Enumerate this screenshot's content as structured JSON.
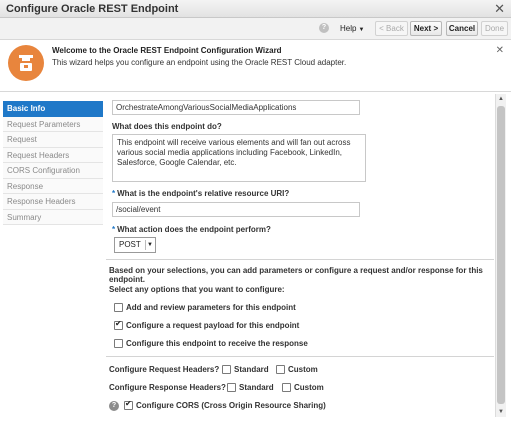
{
  "window": {
    "title": "Configure Oracle REST Endpoint",
    "close_glyph": "✕"
  },
  "toolbar": {
    "help_icon_glyph": "?",
    "help_label": "Help",
    "help_caret": "▼",
    "back_label": "< Back",
    "next_label": "Next >",
    "cancel_label": "Cancel",
    "done_label": "Done"
  },
  "banner": {
    "title": "Welcome to the Oracle REST Endpoint Configuration Wizard",
    "text": "This wizard helps you configure an endpoint using the Oracle REST Cloud adapter.",
    "close_glyph": "✕",
    "icon": "wizard-hat-icon",
    "accent_color": "#e8853d"
  },
  "sidebar": {
    "items": [
      {
        "label": "Basic Info"
      },
      {
        "label": "Request Parameters"
      },
      {
        "label": "Request"
      },
      {
        "label": "Request Headers"
      },
      {
        "label": "CORS Configuration"
      },
      {
        "label": "Response"
      },
      {
        "label": "Response Headers"
      },
      {
        "label": "Summary"
      }
    ],
    "active_color": "#1f78c8"
  },
  "form": {
    "endpoint_name_value": "OrchestrateAmongVariousSocialMediaApplications",
    "description_label": "What does this endpoint do?",
    "description_value": "This endpoint will receive various elements and will fan out across various social media applications including Facebook, LinkedIn, Salesforce, Google Calendar, etc.",
    "required_marker": "*",
    "uri_label": "What is the endpoint's relative resource URI?",
    "uri_value": "/social/event",
    "action_label": "What action does the endpoint perform?",
    "action_value": "POST",
    "action_caret": "▼",
    "selection_intro": "Based on your selections, you can add parameters or configure a request and/or response for this endpoint.",
    "options_label": "Select any options that you want to configure:",
    "options": [
      {
        "label": "Add and review parameters for this endpoint",
        "checked": false
      },
      {
        "label": "Configure a request payload for this endpoint",
        "checked": true
      },
      {
        "label": "Configure this endpoint to receive the response",
        "checked": false
      }
    ],
    "request_headers_label": "Configure Request Headers?",
    "response_headers_label": "Configure Response Headers?",
    "standard_label": "Standard",
    "custom_label": "Custom",
    "help_glyph": "?",
    "cors_label": "Configure CORS (Cross Origin Resource Sharing)",
    "cors_checked": true
  },
  "scrollbar": {
    "up_glyph": "▲",
    "down_glyph": "▼"
  }
}
